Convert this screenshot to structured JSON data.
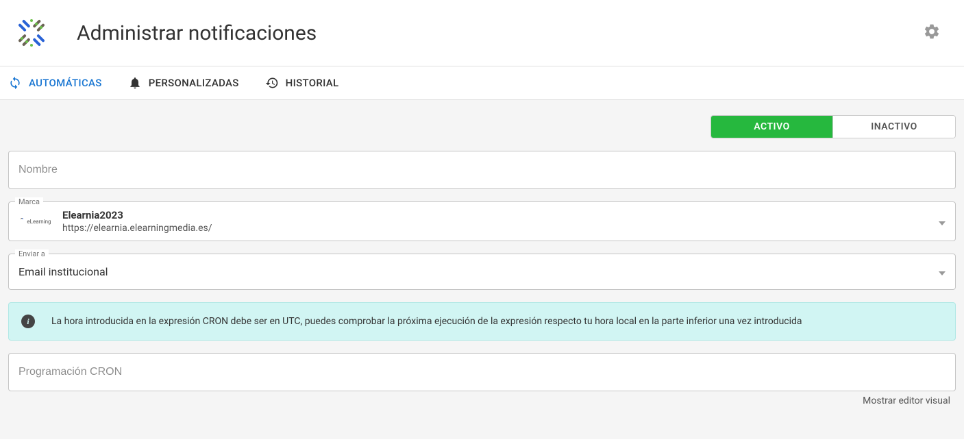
{
  "header": {
    "title": "Administrar notificaciones"
  },
  "tabs": {
    "automatic": "AUTOMÁTICAS",
    "custom": "PERSONALIZADAS",
    "history": "HISTORIAL"
  },
  "statusToggle": {
    "active": "ACTIVO",
    "inactive": "INACTIVO"
  },
  "form": {
    "name": {
      "placeholder": "Nombre"
    },
    "brand": {
      "label": "Marca",
      "iconText": "eLearning",
      "name": "Elearnia2023",
      "url": "https://elearnia.elearningmedia.es/"
    },
    "sendTo": {
      "label": "Enviar a",
      "value": "Email institucional"
    },
    "cronInfo": "La hora introducida en la expresión CRON debe ser en UTC, puedes comprobar la próxima ejecución de la expresión respecto tu hora local en la parte inferior una vez introducida",
    "cronSchedule": {
      "placeholder": "Programación CRON"
    },
    "visualEditorLink": "Mostrar editor visual"
  }
}
